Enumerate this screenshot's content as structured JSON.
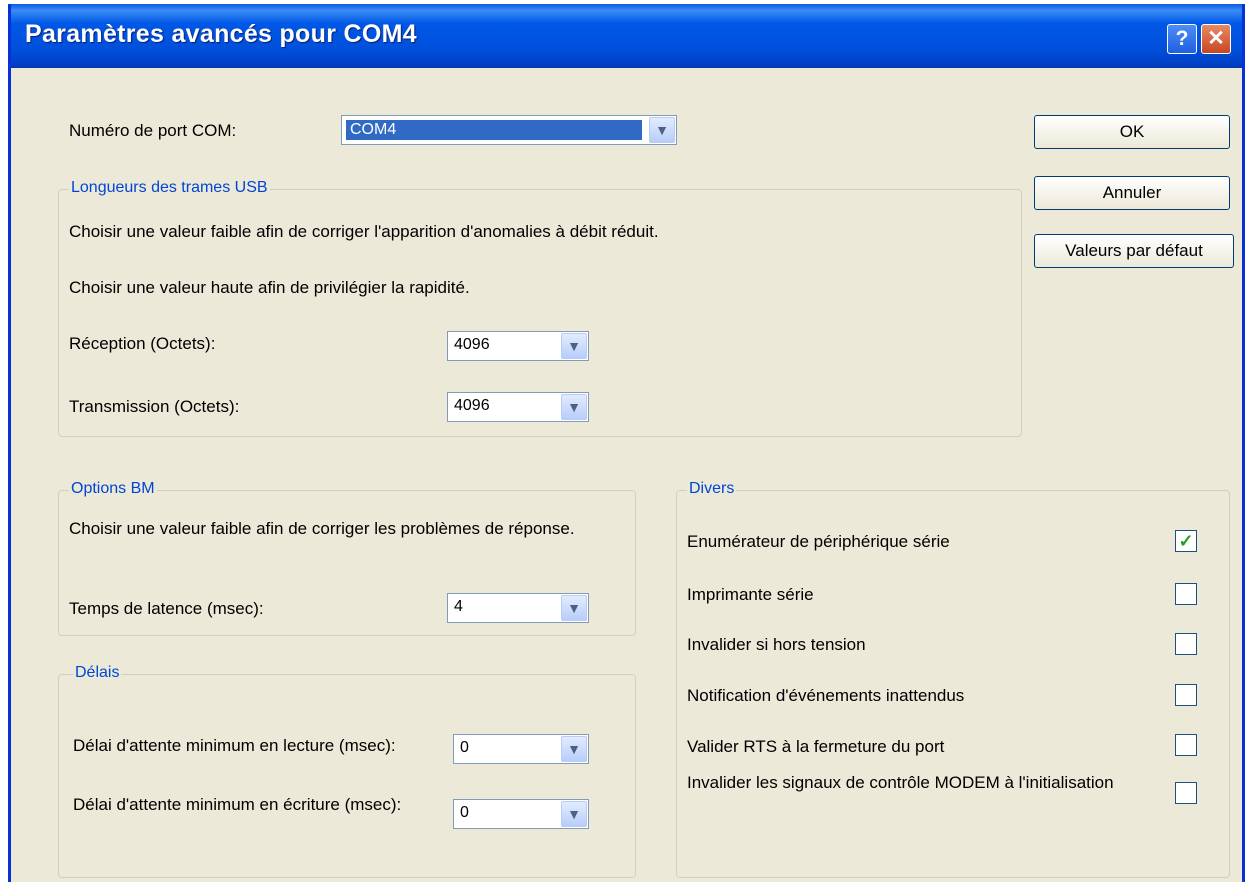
{
  "window": {
    "title": "Paramètres avancés pour COM4",
    "help_glyph": "?",
    "close_glyph": "✕"
  },
  "port": {
    "label": "Numéro de port COM:",
    "value": "COM4"
  },
  "buttons": {
    "ok": "OK",
    "cancel": "Annuler",
    "defaults": "Valeurs par défaut"
  },
  "usb": {
    "title": "Longueurs des trames USB",
    "desc1": "Choisir une valeur faible afin de corriger  l'apparition d'anomalies à débit réduit.",
    "desc2": "Choisir une valeur haute afin de privilégier la rapidité.",
    "reception_label": "Réception (Octets):",
    "reception_value": "4096",
    "transmission_label": "Transmission (Octets):",
    "transmission_value": "4096"
  },
  "bm": {
    "title": "Options BM",
    "desc": "Choisir une valeur faible afin de corriger les problèmes de réponse.",
    "latency_label": "Temps de latence (msec):",
    "latency_value": "4"
  },
  "delays": {
    "title": "Délais",
    "read_label": "Délai d'attente minimum en lecture (msec):",
    "read_value": "0",
    "write_label": "Délai d'attente minimum en écriture (msec):",
    "write_value": "0"
  },
  "misc": {
    "title": "Divers",
    "options": [
      {
        "label": "Enumérateur de périphérique série",
        "checked": true
      },
      {
        "label": "Imprimante série",
        "checked": false
      },
      {
        "label": "Invalider si hors tension",
        "checked": false
      },
      {
        "label": "Notification d'événements inattendus",
        "checked": false
      },
      {
        "label": "Valider RTS à la fermeture du port",
        "checked": false
      },
      {
        "label": "Invalider les signaux de contrôle MODEM à l'initialisation",
        "checked": false
      }
    ]
  },
  "icons": {
    "dropdown_arrow": "chevron-down-icon",
    "check_mark": "check-icon",
    "help": "help-icon",
    "close": "close-icon"
  },
  "colors": {
    "titlebar": "#0058e6",
    "dialog_bg": "#ece9d8",
    "group_label": "#0046d5",
    "selection": "#316ac5",
    "check": "#21a121"
  }
}
